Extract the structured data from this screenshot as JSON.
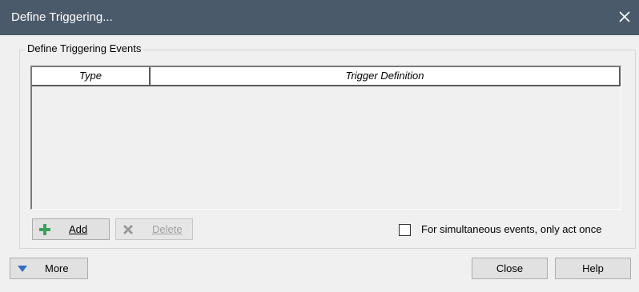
{
  "window": {
    "title": "Define Triggering...",
    "close_glyph": "✕"
  },
  "group": {
    "legend": "Define Triggering Events"
  },
  "table": {
    "columns": [
      "Type",
      "Trigger Definition"
    ],
    "rows": []
  },
  "buttons": {
    "add": {
      "label": "Add",
      "icon": "plus-icon",
      "enabled": true
    },
    "delete": {
      "label": "Delete",
      "icon": "x-icon",
      "enabled": false
    },
    "more": {
      "label": "More",
      "icon": "triangle-down-icon"
    },
    "close": {
      "label": "Close"
    },
    "help": {
      "label": "Help"
    }
  },
  "options": {
    "simultaneous": {
      "label": "For simultaneous events, only act once",
      "checked": false
    }
  },
  "colors": {
    "titlebar": "#4a5a6b",
    "add_icon": "#3aa35b",
    "more_icon": "#2f6fc0"
  }
}
